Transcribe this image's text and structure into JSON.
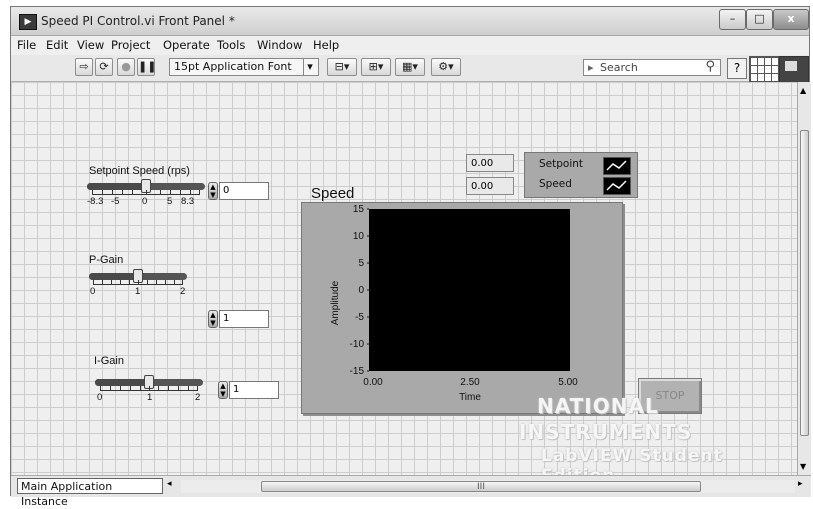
{
  "window": {
    "title": "Speed PI Control.vi Front Panel *",
    "app_icon": "labview-vi-icon"
  },
  "window_controls": {
    "minimize": "–",
    "maximize": "□",
    "close": "x"
  },
  "menu": [
    "File",
    "Edit",
    "View",
    "Project",
    "Operate",
    "Tools",
    "Window",
    "Help"
  ],
  "toolbar": {
    "font": "15pt Application Font",
    "search_placeholder": "Search",
    "help": "?"
  },
  "controls": {
    "setpoint": {
      "label": "Setpoint Speed (rps)",
      "value": "0",
      "ticks": [
        "-8.3",
        "-5",
        "0",
        "5",
        "8.3"
      ],
      "position": 0.5
    },
    "pgain": {
      "label": "P-Gain",
      "value": "1",
      "ticks": [
        "0",
        "1",
        "2"
      ],
      "position": 0.5
    },
    "igain": {
      "label": "I-Gain",
      "value": "1",
      "ticks": [
        "0",
        "1",
        "2"
      ],
      "position": 0.5
    }
  },
  "graph": {
    "title": "Speed",
    "ylabel": "Amplitude",
    "xlabel": "Time",
    "yticks": [
      "15",
      "10",
      "5",
      "0",
      "-5",
      "-10",
      "-15"
    ],
    "xticks": [
      "0.00",
      "2.50",
      "5.00"
    ],
    "cursor_values": [
      "0.00",
      "0.00"
    ],
    "legend": [
      "Setpoint",
      "Speed"
    ]
  },
  "stop_button": "STOP",
  "watermark": {
    "line1": "NATIONAL",
    "line2": "INSTRUMENTS",
    "line3": "LabVIEW Student Edition"
  },
  "status": {
    "context": "Main Application Instance",
    "scroll_marker": "III"
  }
}
